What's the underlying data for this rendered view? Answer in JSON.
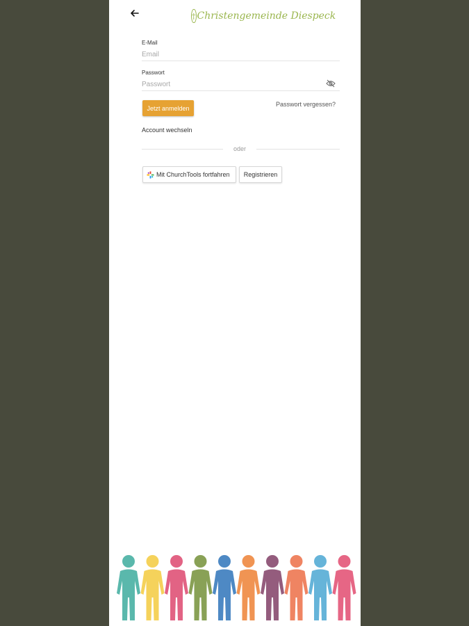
{
  "header": {
    "back_icon": "arrow-left-icon",
    "logo_text": "Christengemeinde Diespeck",
    "logo_color": "#9ab64e"
  },
  "form": {
    "email_label": "E-Mail",
    "email_placeholder": "Email",
    "email_value": "",
    "password_label": "Passwort",
    "password_placeholder": "Passwort",
    "password_value": "",
    "password_visibility_icon": "eye-off-icon",
    "login_label": "Jetzt anmelden",
    "forgot_label": "Passwort vergessen?",
    "switch_account_label": "Account wechseln",
    "divider_label": "oder",
    "churchtools_label": "Mit ChurchTools fortfahren",
    "churchtools_icon": "churchtools-icon",
    "register_label": "Registrieren"
  },
  "colors": {
    "background": "#484a3c",
    "accent": "#e6a233",
    "figures": [
      "#4db3a5",
      "#f5cf4e",
      "#e0567a",
      "#7f9a48",
      "#3f7fbf",
      "#ef8b45",
      "#8c4f73",
      "#ee7a55",
      "#5aaed6",
      "#e45a7b"
    ]
  }
}
